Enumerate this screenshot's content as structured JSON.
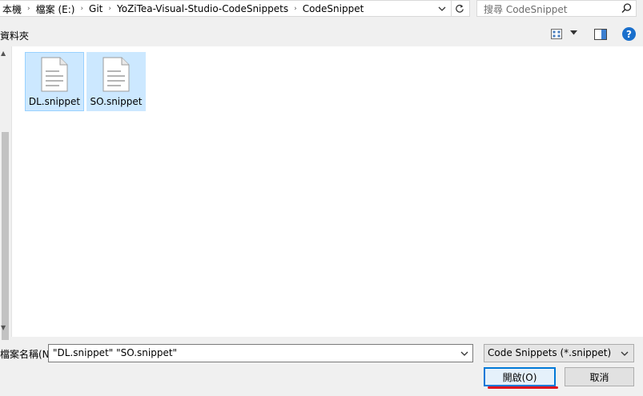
{
  "address": {
    "crumbs": [
      "本機",
      "檔案 (E:)",
      "Git",
      "YoZiTea-Visual-Studio-CodeSnippets",
      "CodeSnippet"
    ],
    "separator": "›"
  },
  "search": {
    "placeholder": "搜尋 CodeSnippet"
  },
  "toolbar": {
    "folder_label": "資料夾",
    "help": "?"
  },
  "files": [
    {
      "name": "DL.snippet",
      "selected": true
    },
    {
      "name": "SO.snippet",
      "selected": true
    }
  ],
  "footer": {
    "filename_label": "檔案名稱(N):",
    "filename_value": "\"DL.snippet\" \"SO.snippet\"",
    "filetype_value": "Code Snippets (*.snippet)",
    "open_label": "開啟(O)",
    "cancel_label": "取消"
  },
  "icons": {
    "refresh": "refresh-icon",
    "search": "search-icon",
    "view": "view-options-icon",
    "preview": "preview-pane-icon",
    "help": "help-icon",
    "file": "document-icon"
  },
  "colors": {
    "selection": "#cce8ff",
    "selection_border": "#99d1ff",
    "primary_button_border": "#0078d7",
    "help": "#1a6fcc",
    "annotation": "#e0141e"
  }
}
